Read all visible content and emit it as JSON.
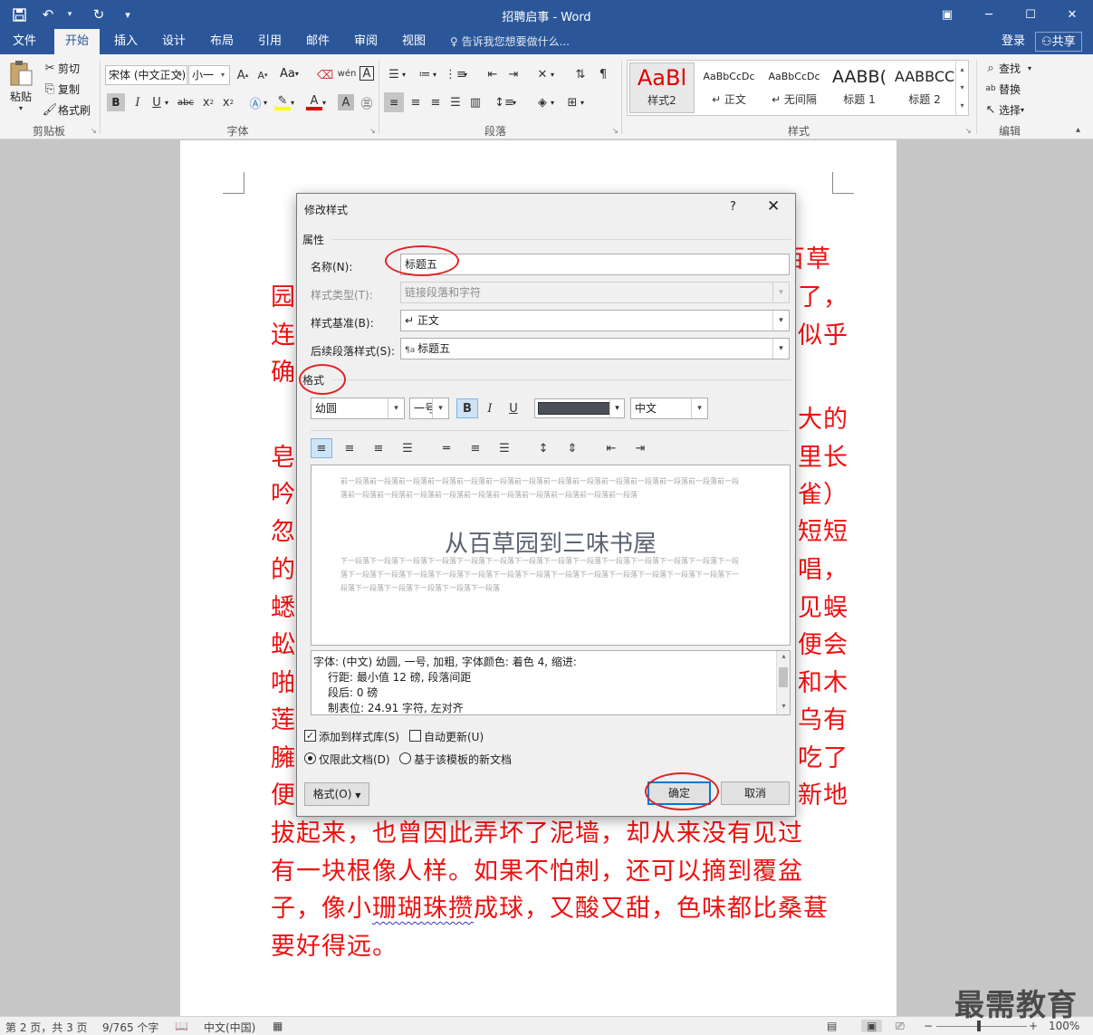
{
  "window": {
    "title": "招聘启事 - Word"
  },
  "tabs": [
    "文件",
    "开始",
    "插入",
    "设计",
    "布局",
    "引用",
    "邮件",
    "审阅",
    "视图"
  ],
  "tell_me": "告诉我您想要做什么...",
  "login": "登录",
  "share": "共享",
  "ribbon": {
    "clipboard": {
      "paste": "粘贴",
      "cut": "剪切",
      "copy": "复制",
      "painter": "格式刷",
      "label": "剪贴板"
    },
    "font": {
      "name": "宋体 (中文正文)",
      "size": "小一",
      "aa": "Aa",
      "label": "字体"
    },
    "paragraph": {
      "label": "段落"
    },
    "styles": {
      "label": "样式",
      "items": [
        {
          "preview": "AaBl",
          "name": "样式2"
        },
        {
          "preview": "AaBbCcDc",
          "name": "↵ 正文"
        },
        {
          "preview": "AaBbCcDc",
          "name": "↵ 无间隔"
        },
        {
          "preview": "AABB(",
          "name": "标题 1"
        },
        {
          "preview": "AABBCC",
          "name": "标题 2"
        }
      ]
    },
    "editing": {
      "find": "查找",
      "replace": "替换",
      "select": "选择",
      "label": "编辑"
    }
  },
  "document": {
    "lines": [
      {
        "text": "百草",
        "right": true
      },
      {
        "text": "园",
        "tail": "了，"
      },
      {
        "text": "连",
        "tail": "似乎"
      },
      {
        "text": "确",
        "tail": ""
      },
      {
        "text": "",
        "tail": "大的"
      },
      {
        "text": "皂",
        "tail": "里长"
      },
      {
        "text": "吟",
        "tail": "雀）"
      },
      {
        "text": "忽",
        "tail": "短短"
      },
      {
        "text": "的",
        "tail": "唱，"
      },
      {
        "text": "蟋",
        "tail": "见蜈"
      },
      {
        "text": "蚣",
        "tail": "便会"
      },
      {
        "text": "啪",
        "tail": "和木"
      },
      {
        "text": "莲",
        "tail": "乌有"
      },
      {
        "text": "臃",
        "tail": "吃了"
      },
      {
        "text": "便",
        "tail": "新地"
      }
    ],
    "full_lines": [
      "拔起来，也曾因此弄坏了泥墙，却从来没有见过",
      "有一块根像人样。如果不怕刺，还可以摘到覆盆",
      "子，像小珊瑚珠攒成球，又酸又甜，色味都比桑葚",
      "要好得远。"
    ]
  },
  "dialog": {
    "title": "修改样式",
    "help": "?",
    "properties_label": "属性",
    "name_label": "名称(N):",
    "name_value": "标题五",
    "type_label": "样式类型(T):",
    "type_value": "链接段落和字符",
    "based_label": "样式基准(B):",
    "based_value": "↵ 正文",
    "next_label": "后续段落样式(S):",
    "next_value": "标题五",
    "format_label": "格式",
    "font_value": "幼圆",
    "size_value": "一号",
    "bold": "B",
    "italic": "I",
    "underline": "U",
    "lang_value": "中文",
    "preview_before": "前一段落前一段落前一段落前一段落前一段落前一段落前一段落前一段落前一段落前一段落前一段落前一段落前一段落前一段落前一段落前一段落前一段落前一段落前一段落前一段落前一段落前一段落前一段落前一段落",
    "preview_text": "从百草园到三味书屋",
    "preview_after": "下一段落下一段落下一段落下一段落下一段落下一段落下一段落下一段落下一段落下一段落下一段落下一段落下一段落下一段落下一段落下一段落下一段落下一段落下一段落下一段落下一段落下一段落下一段落下一段落下一段落下一段落下一段落下一段落下一段落下一段落下一段落下一段落下一段落",
    "desc_lines": [
      "字体: (中文) 幼圆, 一号, 加粗, 字体颜色: 着色 4, 缩进:",
      "行距: 最小值 12 磅, 段落间距",
      "段后: 0 磅",
      "制表位: 24.91 字符, 左对齐"
    ],
    "add_gallery": "添加到样式库(S)",
    "auto_update": "自动更新(U)",
    "only_doc": "仅限此文档(D)",
    "new_docs": "基于该模板的新文档",
    "format_btn": "格式(O)",
    "ok": "确定",
    "cancel": "取消"
  },
  "status": {
    "page": "第 2 页，共 3 页",
    "words": "9/765 个字",
    "lang": "中文(中国)",
    "zoom": "100%"
  },
  "watermark": "最需教育"
}
